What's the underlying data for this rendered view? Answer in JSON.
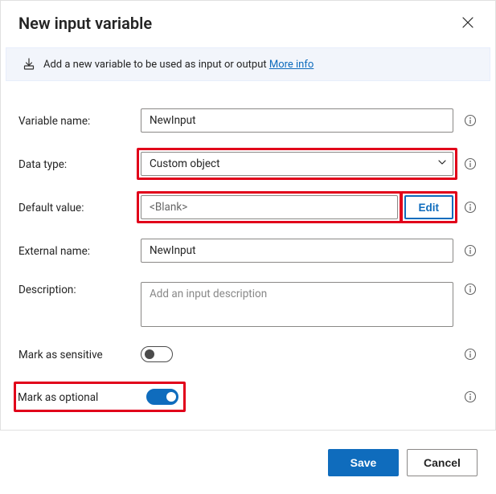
{
  "header": {
    "title": "New input variable"
  },
  "banner": {
    "text": "Add a new variable to be used as input or output ",
    "link_label": "More info"
  },
  "fields": {
    "variable_name": {
      "label": "Variable name:",
      "value": "NewInput"
    },
    "data_type": {
      "label": "Data type:",
      "value": "Custom object"
    },
    "default_value": {
      "label": "Default value:",
      "value": "<Blank>",
      "edit_label": "Edit"
    },
    "external_name": {
      "label": "External name:",
      "value": "NewInput"
    },
    "description": {
      "label": "Description:",
      "placeholder": "Add an input description",
      "value": ""
    },
    "mark_sensitive": {
      "label": "Mark as sensitive",
      "value": false
    },
    "mark_optional": {
      "label": "Mark as optional",
      "value": true
    }
  },
  "footer": {
    "save_label": "Save",
    "cancel_label": "Cancel"
  },
  "icons": {
    "close": "close-icon",
    "download": "input-icon",
    "info": "info-icon",
    "chevron": "chevron-down-icon"
  }
}
